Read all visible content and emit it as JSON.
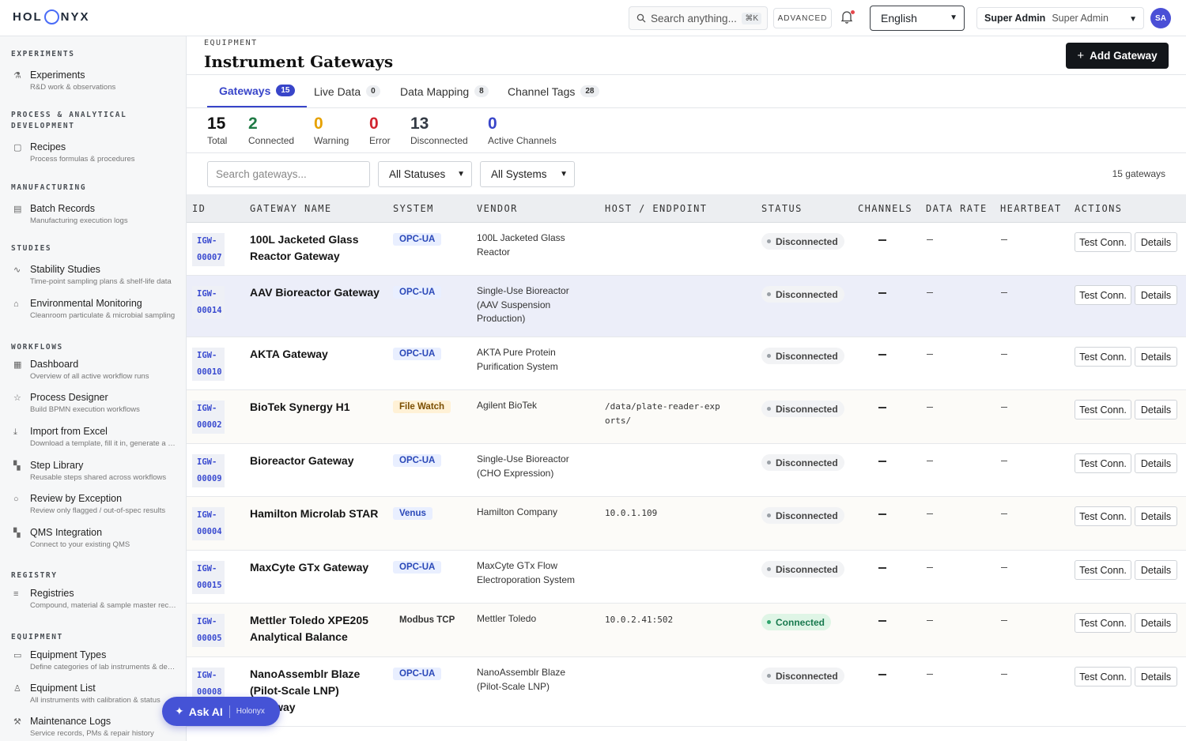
{
  "topbar": {
    "logo_left": "HOL",
    "logo_right": "NYX",
    "search_placeholder": "Search anything...",
    "search_shortcut": "⌘K",
    "advanced_label": "ADVANCED",
    "language": "English",
    "user_name": "Super Admin",
    "user_role": "Super Admin",
    "avatar_initials": "SA"
  },
  "sidebar": {
    "sections": [
      {
        "title": "EXPERIMENTS",
        "items": [
          {
            "icon": "flask-icon",
            "label": "Experiments",
            "sub": "R&D work & observations"
          }
        ]
      },
      {
        "title": "PROCESS & ANALYTICAL DEVELOPMENT",
        "items": [
          {
            "icon": "document-icon",
            "label": "Recipes",
            "sub": "Process formulas & procedures"
          }
        ]
      },
      {
        "title": "MANUFACTURING",
        "items": [
          {
            "icon": "clipboard-icon",
            "label": "Batch Records",
            "sub": "Manufacturing execution logs"
          }
        ]
      },
      {
        "title": "STUDIES",
        "items": [
          {
            "icon": "pulse-icon",
            "label": "Stability Studies",
            "sub": "Time-point sampling plans & shelf-life data"
          },
          {
            "icon": "home-icon",
            "label": "Environmental Monitoring",
            "sub": "Cleanroom particulate & microbial sampling"
          }
        ]
      },
      {
        "title": "WORKFLOWS",
        "items": [
          {
            "icon": "grid-icon",
            "label": "Dashboard",
            "sub": "Overview of all active workflow runs"
          },
          {
            "icon": "star-icon",
            "label": "Process Designer",
            "sub": "Build BPMN execution workflows"
          },
          {
            "icon": "download-icon",
            "label": "Import from Excel",
            "sub": "Download a template, fill it in, generate a workflow"
          },
          {
            "icon": "blocks-icon",
            "label": "Step Library",
            "sub": "Reusable steps shared across workflows"
          },
          {
            "icon": "magnifier-icon",
            "label": "Review by Exception",
            "sub": "Review only flagged / out-of-spec results"
          },
          {
            "icon": "blocks-icon",
            "label": "QMS Integration",
            "sub": "Connect to your existing QMS"
          }
        ]
      },
      {
        "title": "REGISTRY",
        "items": [
          {
            "icon": "database-icon",
            "label": "Registries",
            "sub": "Compound, material & sample master records"
          }
        ]
      },
      {
        "title": "EQUIPMENT",
        "items": [
          {
            "icon": "toolbox-icon",
            "label": "Equipment Types",
            "sub": "Define categories of lab instruments & devices"
          },
          {
            "icon": "user-icon",
            "label": "Equipment List",
            "sub": "All instruments with calibration & status"
          },
          {
            "icon": "wrench-icon",
            "label": "Maintenance Logs",
            "sub": "Service records, PMs & repair history"
          }
        ]
      }
    ]
  },
  "header": {
    "eyebrow": "EQUIPMENT",
    "title": "Instrument Gateways",
    "add_button": "Add Gateway"
  },
  "tabs": [
    {
      "label": "Gateways",
      "count": "15",
      "active": true
    },
    {
      "label": "Live Data",
      "count": "0",
      "active": false
    },
    {
      "label": "Data Mapping",
      "count": "8",
      "active": false
    },
    {
      "label": "Channel Tags",
      "count": "28",
      "active": false
    }
  ],
  "stats": [
    {
      "value": "15",
      "label": "Total",
      "color": "#111111"
    },
    {
      "value": "2",
      "label": "Connected",
      "color": "#1f7a45"
    },
    {
      "value": "0",
      "label": "Warning",
      "color": "#e6a100"
    },
    {
      "value": "0",
      "label": "Error",
      "color": "#d1242f"
    },
    {
      "value": "13",
      "label": "Disconnected",
      "color": "#333a44"
    },
    {
      "value": "0",
      "label": "Active Channels",
      "color": "#3845c9"
    }
  ],
  "filters": {
    "search_placeholder": "Search gateways...",
    "status_select": "All Statuses",
    "system_select": "All Systems",
    "count_text": "15 gateways"
  },
  "table": {
    "columns": [
      "ID",
      "GATEWAY NAME",
      "SYSTEM",
      "VENDOR",
      "HOST / ENDPOINT",
      "STATUS",
      "CHANNELS",
      "DATA RATE",
      "HEARTBEAT",
      "ACTIONS"
    ],
    "test_label": "Test Conn.",
    "details_label": "Details",
    "rows": [
      {
        "id": [
          "IGW-",
          "00007"
        ],
        "name": "100L Jacketed Glass Reactor Gateway",
        "system": "OPC-UA",
        "system_kind": "opc",
        "vendor": "100L Jacketed Glass Reactor",
        "host": "",
        "status": "Disconnected",
        "status_kind": "disc",
        "highlight": false
      },
      {
        "id": [
          "IGW-",
          "00014"
        ],
        "name": "AAV Bioreactor Gateway",
        "system": "OPC-UA",
        "system_kind": "opc",
        "vendor": "Single-Use Bioreactor (AAV Suspension Production)",
        "host": "",
        "status": "Disconnected",
        "status_kind": "disc",
        "highlight": true
      },
      {
        "id": [
          "IGW-",
          "00010"
        ],
        "name": "AKTA Gateway",
        "system": "OPC-UA",
        "system_kind": "opc",
        "vendor": "AKTA Pure Protein Purification System",
        "host": "",
        "status": "Disconnected",
        "status_kind": "disc",
        "highlight": false
      },
      {
        "id": [
          "IGW-",
          "00002"
        ],
        "name": "BioTek Synergy H1",
        "system": "File Watch",
        "system_kind": "file",
        "vendor": "Agilent BioTek",
        "host": "/data/plate-reader-exports/",
        "status": "Disconnected",
        "status_kind": "disc",
        "highlight": false
      },
      {
        "id": [
          "IGW-",
          "00009"
        ],
        "name": "Bioreactor Gateway",
        "system": "OPC-UA",
        "system_kind": "opc",
        "vendor": "Single-Use Bioreactor (CHO Expression)",
        "host": "",
        "status": "Disconnected",
        "status_kind": "disc",
        "highlight": false
      },
      {
        "id": [
          "IGW-",
          "00004"
        ],
        "name": "Hamilton Microlab STAR",
        "system": "Venus",
        "system_kind": "venus",
        "vendor": "Hamilton Company",
        "host": "10.0.1.109",
        "status": "Disconnected",
        "status_kind": "disc",
        "highlight": false
      },
      {
        "id": [
          "IGW-",
          "00015"
        ],
        "name": "MaxCyte GTx Gateway",
        "system": "OPC-UA",
        "system_kind": "opc",
        "vendor": "MaxCyte GTx Flow Electroporation System",
        "host": "",
        "status": "Disconnected",
        "status_kind": "disc",
        "highlight": false
      },
      {
        "id": [
          "IGW-",
          "00005"
        ],
        "name": "Mettler Toledo XPE205 Analytical Balance",
        "system": "Modbus TCP",
        "system_kind": "modbus",
        "vendor": "Mettler Toledo",
        "host": "10.0.2.41:502",
        "status": "Connected",
        "status_kind": "conn",
        "highlight": false
      },
      {
        "id": [
          "IGW-",
          "00008"
        ],
        "name": "NanoAssemblr Blaze (Pilot-Scale LNP) Gateway",
        "system": "OPC-UA",
        "system_kind": "opc",
        "vendor": "NanoAssemblr Blaze (Pilot-Scale LNP)",
        "host": "",
        "status": "Disconnected",
        "status_kind": "disc",
        "highlight": false
      }
    ]
  },
  "ask_ai": {
    "label": "Ask AI",
    "brand": "Holonyx"
  },
  "colors": {
    "accent": "#3845c9",
    "row_highlight": "#eceef9",
    "row_alt": "#fcfbf8"
  }
}
